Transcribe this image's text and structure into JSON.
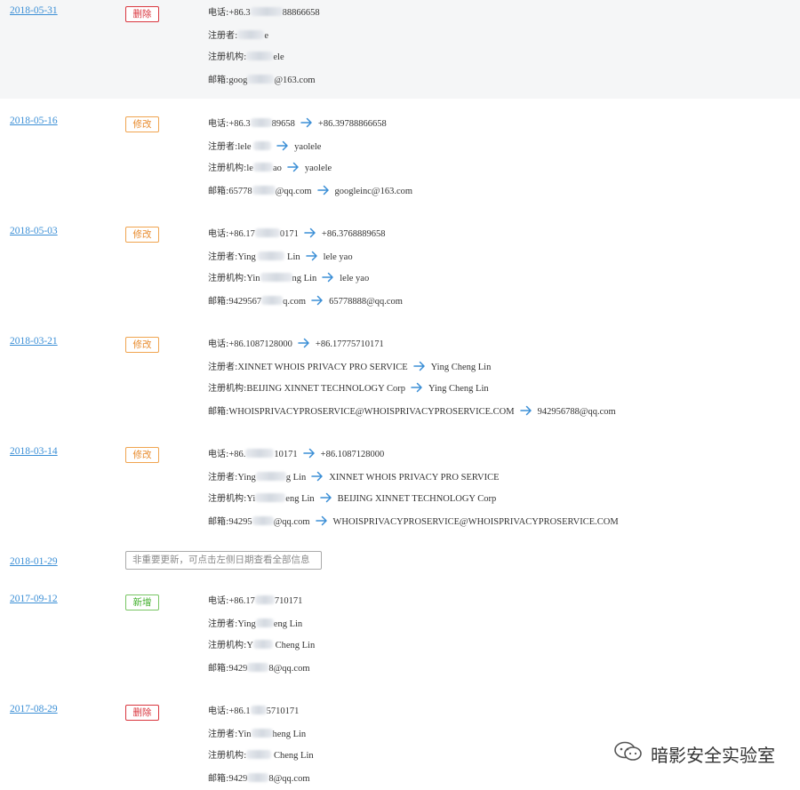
{
  "labels": {
    "phone": "电话:",
    "registrant": "注册者:",
    "org": "注册机构:",
    "email": "邮箱:"
  },
  "watermark": {
    "text": "暗影安全实验室",
    "icon": "wechat-icon"
  },
  "colors": {
    "date": "#3b8fd6",
    "arrow": "#3b8fd6",
    "delete": "#d9363e",
    "modify": "#e88b2e",
    "add": "#3fae2a"
  },
  "entries": [
    {
      "date": "2018-05-31",
      "badge": "删除",
      "type": "delete",
      "highlight": true,
      "link": true,
      "rows": [
        {
          "field": "phone",
          "old": "+86.3",
          "old_mask": 36,
          "old_tail": "88866658"
        },
        {
          "field": "registrant",
          "old": "",
          "old_mask": 30,
          "old_tail": "e"
        },
        {
          "field": "org",
          "old": "",
          "old_mask": 30,
          "old_tail": "ele"
        },
        {
          "field": "email",
          "old": "goog",
          "old_mask": 30,
          "old_tail": "@163.com"
        }
      ]
    },
    {
      "date": "2018-05-16",
      "badge": "修改",
      "type": "modify",
      "rows": [
        {
          "field": "phone",
          "old": "+86.3",
          "old_mask": 24,
          "old_tail": "89658",
          "new": "+86.39788866658"
        },
        {
          "field": "registrant",
          "old": "lele ",
          "old_mask": 20,
          "old_tail": "",
          "new": "yaolele"
        },
        {
          "field": "org",
          "old": "le",
          "old_mask": 22,
          "old_tail": "ao",
          "new": "yaolele"
        },
        {
          "field": "email",
          "old": "65778",
          "old_mask": 26,
          "old_tail": "@qq.com",
          "new": "googleinc@163.com"
        }
      ]
    },
    {
      "date": "2018-05-03",
      "badge": "修改",
      "type": "modify",
      "rows": [
        {
          "field": "phone",
          "old": "+86.17",
          "old_mask": 28,
          "old_tail": "0171",
          "new": "+86.3768889658"
        },
        {
          "field": "registrant",
          "old": "Ying ",
          "old_mask": 30,
          "old_tail": " Lin",
          "new": "lele yao"
        },
        {
          "field": "org",
          "old": "Yin",
          "old_mask": 36,
          "old_tail": "ng Lin",
          "new": "lele yao"
        },
        {
          "field": "email",
          "old": "9429567",
          "old_mask": 24,
          "old_tail": "q.com",
          "new": "65778888@qq.com"
        }
      ]
    },
    {
      "date": "2018-03-21",
      "badge": "修改",
      "type": "modify",
      "rows": [
        {
          "field": "phone",
          "old": "+86.1087128000",
          "new": "+86.17775710171"
        },
        {
          "field": "registrant",
          "old": "XINNET WHOIS PRIVACY PRO SERVICE",
          "new": "Ying Cheng Lin"
        },
        {
          "field": "org",
          "old": "BEIJING XINNET TECHNOLOGY Corp",
          "new": "Ying Cheng Lin"
        },
        {
          "field": "email",
          "old": "WHOISPRIVACYPROSERVICE@WHOISPRIVACYPROSERVICE.COM",
          "new": "942956788@qq.com"
        }
      ]
    },
    {
      "date": "2018-03-14",
      "badge": "修改",
      "type": "modify",
      "rows": [
        {
          "field": "phone",
          "old": "+86.",
          "old_mask": 32,
          "old_tail": "10171",
          "new": "+86.1087128000"
        },
        {
          "field": "registrant",
          "old": "Ying",
          "old_mask": 34,
          "old_tail": "g Lin",
          "new": "XINNET WHOIS PRIVACY PRO SERVICE"
        },
        {
          "field": "org",
          "old": "Yi",
          "old_mask": 34,
          "old_tail": "eng Lin",
          "new": "BEIJING XINNET TECHNOLOGY Corp"
        },
        {
          "field": "email",
          "old": "94295",
          "old_mask": 24,
          "old_tail": "@qq.com",
          "new": "WHOISPRIVACYPROSERVICE@WHOISPRIVACYPROSERVICE.COM"
        }
      ]
    },
    {
      "date": "2018-01-29",
      "badge": "非重要更新，可点击左侧日期查看全部信息",
      "type": "note",
      "rows": []
    },
    {
      "date": "2017-09-12",
      "badge": "新增",
      "type": "add",
      "rows": [
        {
          "field": "phone",
          "old": "+86.17",
          "old_mask": 22,
          "old_tail": "710171"
        },
        {
          "field": "registrant",
          "old": "Ying",
          "old_mask": 20,
          "old_tail": "eng Lin"
        },
        {
          "field": "org",
          "old": "Y",
          "old_mask": 22,
          "old_tail": " Cheng Lin"
        },
        {
          "field": "email",
          "old": "9429",
          "old_mask": 24,
          "old_tail": "8@qq.com"
        }
      ]
    },
    {
      "date": "2017-08-29",
      "badge": "删除",
      "type": "delete",
      "rows": [
        {
          "field": "phone",
          "old": "+86.1",
          "old_mask": 18,
          "old_tail": "5710171"
        },
        {
          "field": "registrant",
          "old": "Yin",
          "old_mask": 24,
          "old_tail": "heng Lin"
        },
        {
          "field": "org",
          "old": "",
          "old_mask": 28,
          "old_tail": " Cheng Lin"
        },
        {
          "field": "email",
          "old": "9429",
          "old_mask": 24,
          "old_tail": "8@qq.com"
        }
      ]
    }
  ]
}
